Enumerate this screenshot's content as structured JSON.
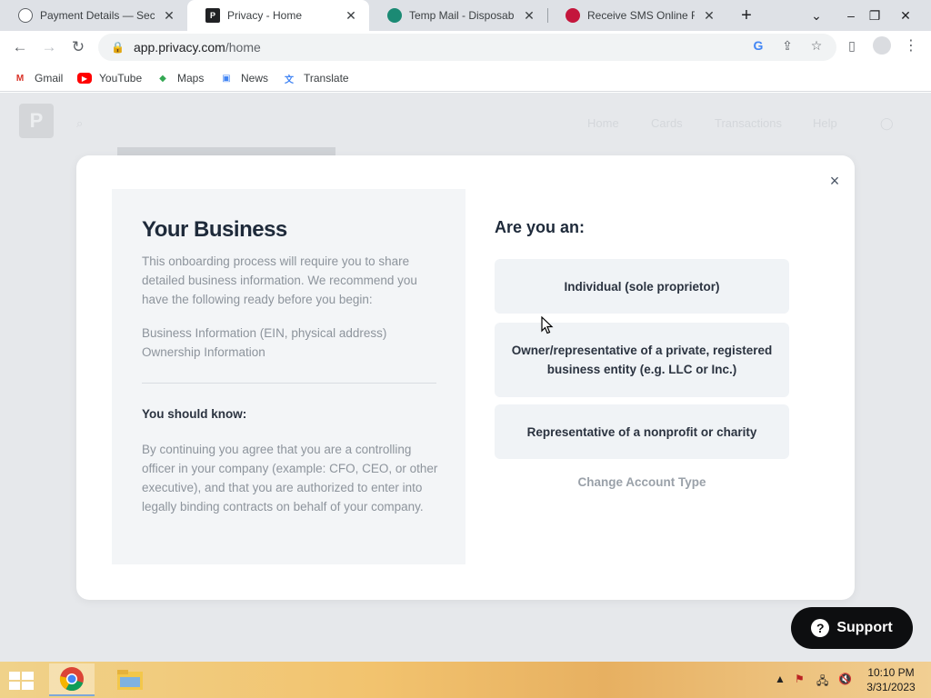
{
  "browser": {
    "tabs": [
      {
        "title": "Payment Details — Secur",
        "favicon": "globe-icon",
        "favicon_color": "#5f6368",
        "active": false
      },
      {
        "title": "Privacy - Home",
        "favicon": "privacy-p-icon",
        "favicon_color": "#202124",
        "active": true
      },
      {
        "title": "Temp Mail - Disposable T",
        "favicon": "temp-mail-icon",
        "favicon_color": "#1b8a74",
        "active": false
      },
      {
        "title": "Receive SMS Online For",
        "favicon": "sms-icon",
        "favicon_color": "#c4163c",
        "active": false
      }
    ],
    "new_tab": "+",
    "url_host": "app.privacy.com",
    "url_path": "/home",
    "bookmarks": [
      {
        "label": "Gmail",
        "icon": "gmail-icon",
        "color": "#d93025"
      },
      {
        "label": "YouTube",
        "icon": "youtube-icon",
        "color": "#ff0000"
      },
      {
        "label": "Maps",
        "icon": "maps-icon",
        "color": "#34a853"
      },
      {
        "label": "News",
        "icon": "news-icon",
        "color": "#4285f4"
      },
      {
        "label": "Translate",
        "icon": "translate-icon",
        "color": "#4285f4"
      }
    ]
  },
  "app": {
    "logo_letter": "P",
    "nav_items": [
      "Home",
      "Cards",
      "Transactions",
      "Help"
    ]
  },
  "modal": {
    "title": "Your Business",
    "intro": "This onboarding process will require you to share detailed business information. We recommend you have the following ready before you begin:",
    "requirements": [
      "Business Information (EIN, physical address)",
      "Ownership Information"
    ],
    "know_heading": "You should know:",
    "know_text": "By continuing you agree that you are a controlling officer in your company (example: CFO, CEO, or other executive), and that you are authorized to enter into legally binding contracts on behalf of your company.",
    "question": "Are you an:",
    "options": [
      "Individual (sole proprietor)",
      "Owner/representative of a private, registered business entity (e.g. LLC or Inc.)",
      "Representative of a nonprofit or charity"
    ],
    "change_type": "Change Account Type",
    "close": "×"
  },
  "support": {
    "label": "Support"
  },
  "taskbar": {
    "time": "10:10 PM",
    "date": "3/31/2023"
  }
}
